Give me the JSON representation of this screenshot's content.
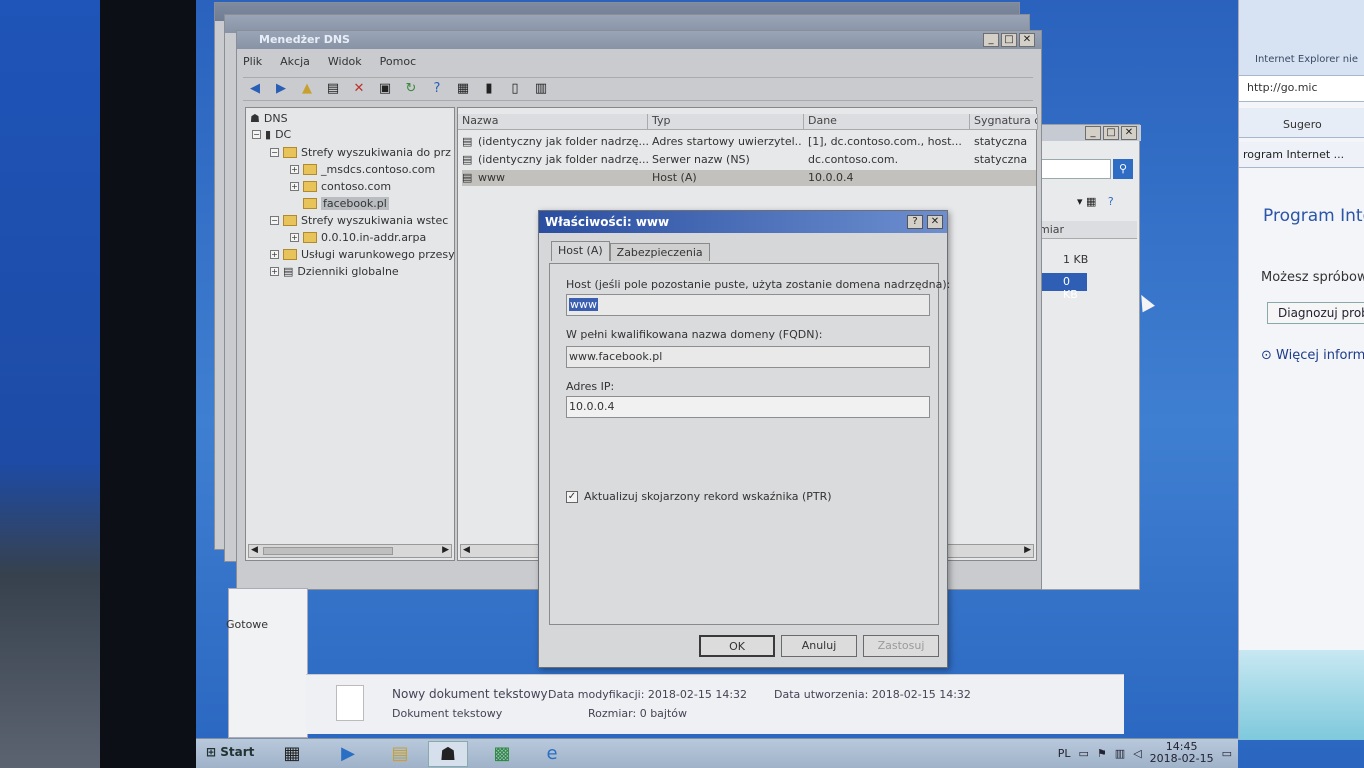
{
  "ie_right": {
    "title": "Internet Explorer nie",
    "address": "http://go.mic",
    "favorite_label": "Sugero",
    "tab_label": "rogram Internet ...",
    "heading": "Program Inte",
    "body": "Możesz spróbow",
    "diagnose_button": "Diagnozuj prob",
    "more_info": "Więcej inform"
  },
  "dns_window": {
    "title": "Menedżer DNS",
    "menu": [
      "Plik",
      "Akcja",
      "Widok",
      "Pomoc"
    ],
    "status": "Gotowe",
    "tree": [
      {
        "label": "DNS"
      },
      {
        "label": "DC"
      },
      {
        "label": "Strefy wyszukiwania do prz"
      },
      {
        "label": "_msdcs.contoso.com"
      },
      {
        "label": "contoso.com"
      },
      {
        "label": "facebook.pl"
      },
      {
        "label": "Strefy wyszukiwania wstec"
      },
      {
        "label": "0.0.10.in-addr.arpa"
      },
      {
        "label": "Usługi warunkowego przesy"
      },
      {
        "label": "Dzienniki globalne"
      }
    ],
    "columns": [
      "Nazwa",
      "Typ",
      "Dane",
      "Sygnatura cz"
    ],
    "rows": [
      {
        "name": "(identyczny jak folder nadrzę...",
        "type": "Adres startowy uwierzytel...",
        "data": "[1], dc.contoso.com., host...",
        "sig": "statyczna"
      },
      {
        "name": "(identyczny jak folder nadrzę...",
        "type": "Serwer nazw (NS)",
        "data": "dc.contoso.com.",
        "sig": "statyczna"
      },
      {
        "name": "www",
        "type": "Host (A)",
        "data": "10.0.0.4",
        "sig": ""
      }
    ]
  },
  "back_window": {
    "col_label": "miar",
    "size1": "1 KB",
    "size2": "0 KB"
  },
  "dialog": {
    "title": "Właściwości: www",
    "help": "?",
    "close": "✕",
    "tabs": [
      "Host (A)",
      "Zabezpieczenia"
    ],
    "host_label": "Host (jeśli pole pozostanie puste, użyta zostanie domena nadrzędna):",
    "host_value": "www",
    "fqdn_label": "W pełni kwalifikowana nazwa domeny (FQDN):",
    "fqdn_value": "www.facebook.pl",
    "ip_label": "Adres IP:",
    "ip_value": "10.0.0.4",
    "ptr_label": "Aktualizuj skojarzony rekord wskaźnika (PTR)",
    "ok": "OK",
    "cancel": "Anuluj",
    "apply": "Zastosuj"
  },
  "explorer_details": {
    "file_name": "Nowy dokument tekstowy",
    "file_type": "Dokument tekstowy",
    "modified": "Data modyfikacji: 2018-02-15 14:32",
    "size": "Rozmiar: 0 bajtów",
    "created": "Data utworzenia: 2018-02-15 14:32"
  },
  "taskbar": {
    "start": "Start",
    "lang": "PL",
    "time": "14:45",
    "date": "2018-02-15"
  }
}
